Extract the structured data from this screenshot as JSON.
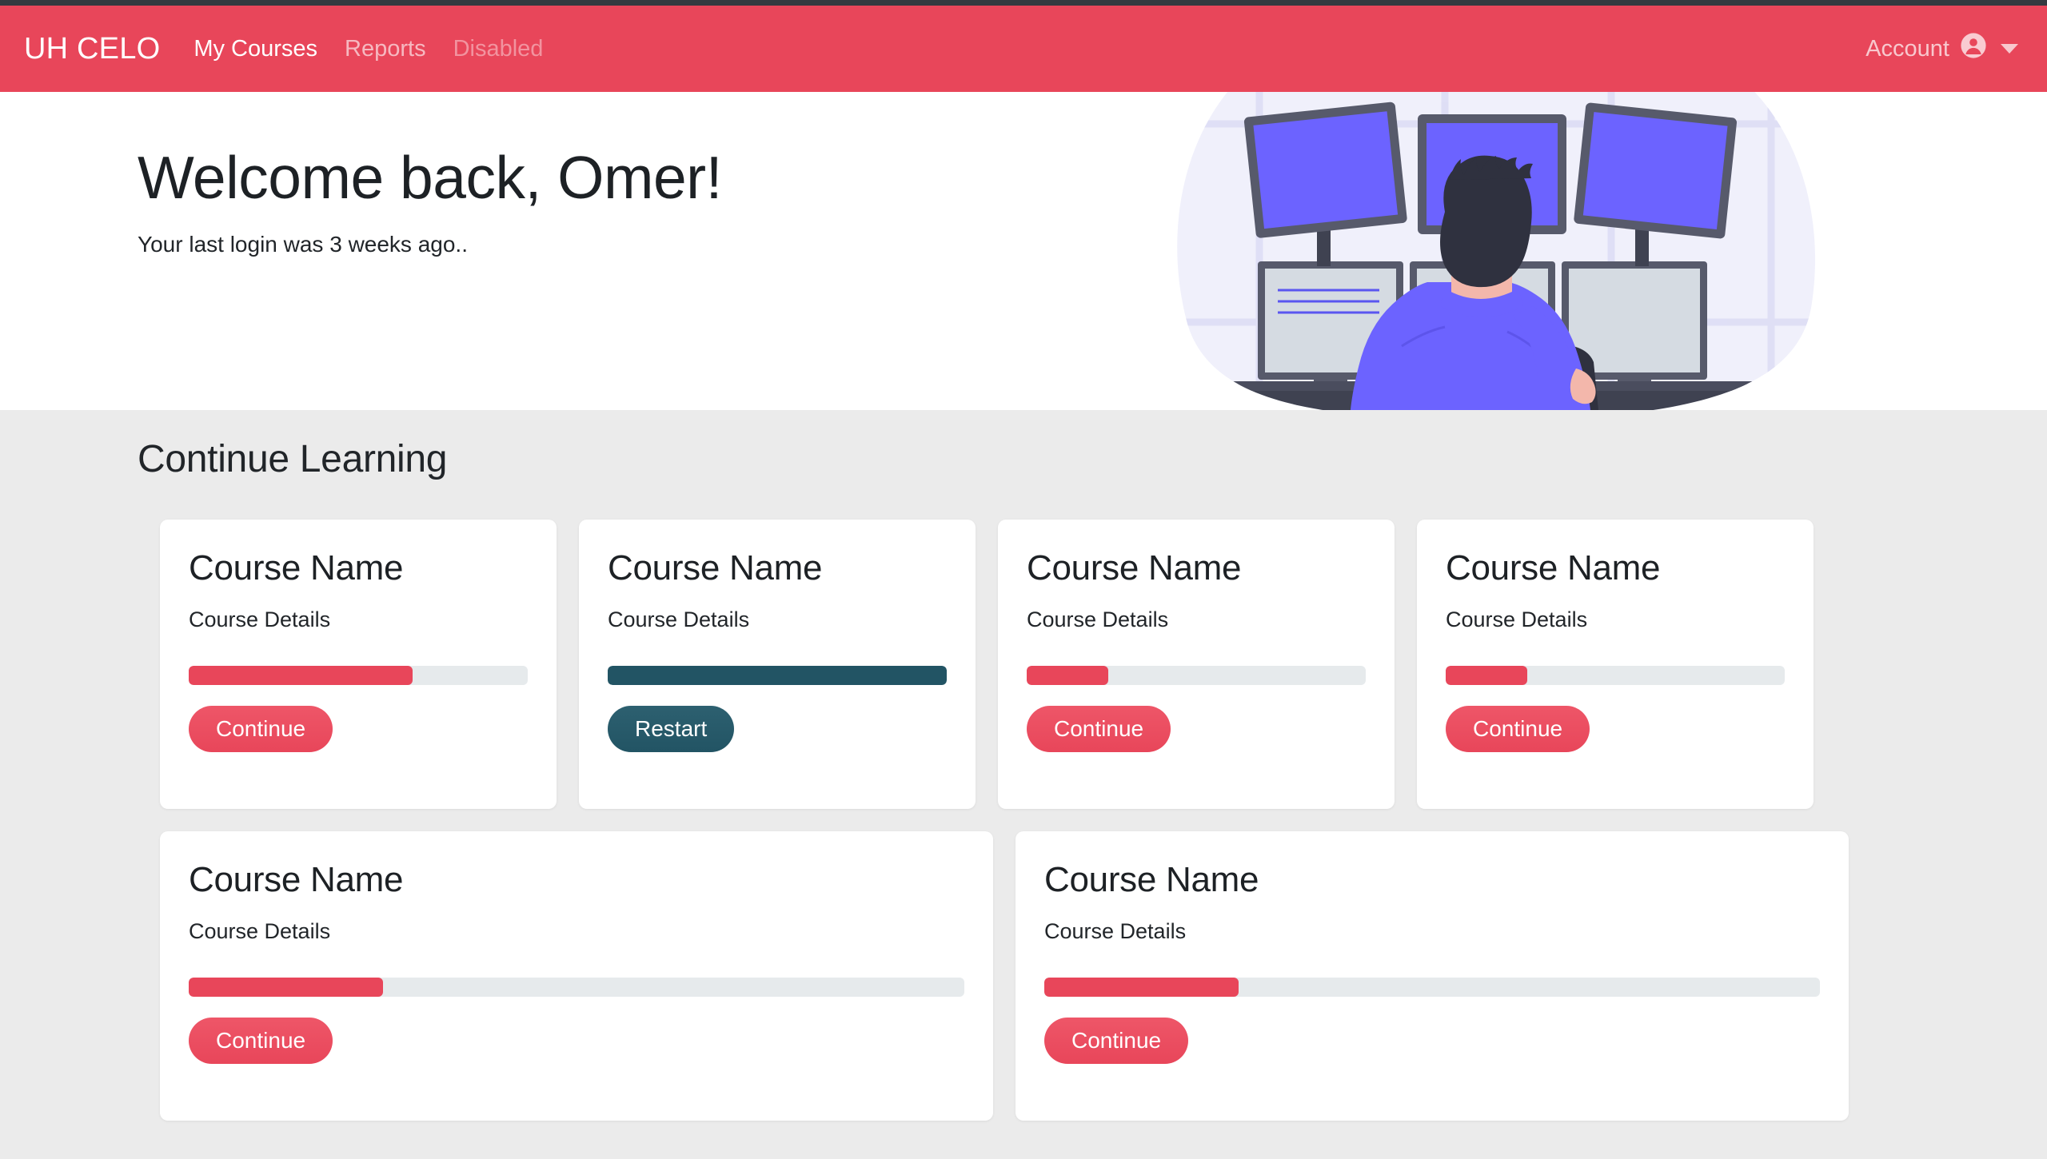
{
  "theme": {
    "brand_red": "#e8465a",
    "teal": "#225464",
    "page_bg": "#ebebeb",
    "card_bg": "#ffffff",
    "progress_track": "#e6eaec",
    "top_strip": "#343a40"
  },
  "navbar": {
    "brand": "UH CELO",
    "links": [
      {
        "label": "My Courses",
        "state": "active"
      },
      {
        "label": "Reports",
        "state": "muted"
      },
      {
        "label": "Disabled",
        "state": "disabled"
      }
    ],
    "account": {
      "label": "Account",
      "avatar_icon": "person-circle-icon",
      "caret_icon": "chevron-down-icon"
    }
  },
  "hero": {
    "title": "Welcome back, Omer!",
    "subtitle": "Your last login was 3 weeks ago..",
    "illustration": "workstation-three-monitors-illustration"
  },
  "main": {
    "section_title": "Continue Learning",
    "cards": [
      {
        "title": "Course Name",
        "details": "Course Details",
        "progress_percent": 66,
        "progress_color": "#e8465a",
        "button_label": "Continue",
        "button_style": "primary",
        "width": "w1"
      },
      {
        "title": "Course Name",
        "details": "Course Details",
        "progress_percent": 100,
        "progress_color": "#225464",
        "button_label": "Restart",
        "button_style": "teal",
        "width": "w1"
      },
      {
        "title": "Course Name",
        "details": "Course Details",
        "progress_percent": 24,
        "progress_color": "#e8465a",
        "button_label": "Continue",
        "button_style": "primary",
        "width": "w1"
      },
      {
        "title": "Course Name",
        "details": "Course Details",
        "progress_percent": 24,
        "progress_color": "#e8465a",
        "button_label": "Continue",
        "button_style": "primary",
        "width": "w1"
      },
      {
        "title": "Course Name",
        "details": "Course Details",
        "progress_percent": 25,
        "progress_color": "#e8465a",
        "button_label": "Continue",
        "button_style": "primary",
        "width": "w2"
      },
      {
        "title": "Course Name",
        "details": "Course Details",
        "progress_percent": 25,
        "progress_color": "#e8465a",
        "button_label": "Continue",
        "button_style": "primary",
        "width": "w2"
      }
    ]
  }
}
